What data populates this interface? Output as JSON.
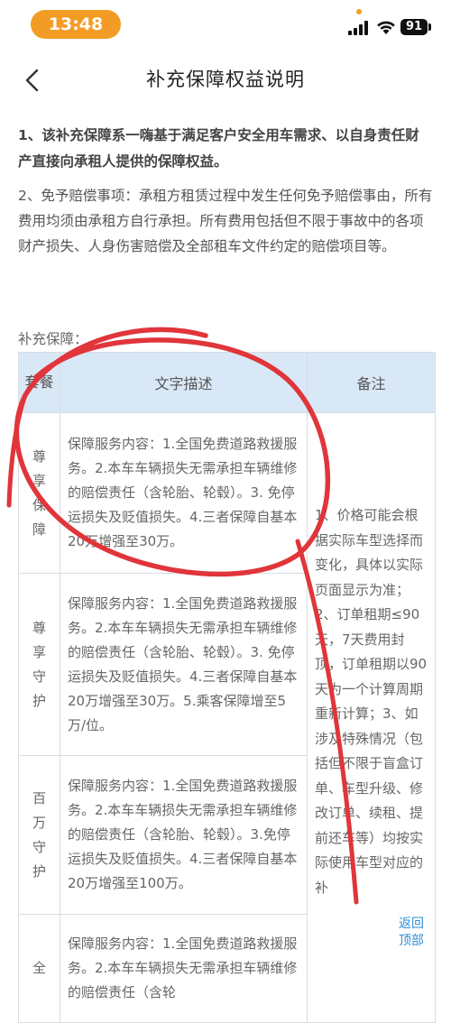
{
  "status": {
    "time": "13:48",
    "battery": "91"
  },
  "nav": {
    "title": "补充保障权益说明"
  },
  "content": {
    "p1": "1、该补充保障系一嗨基于满足客户安全用车需求、以自身责任财产直接向承租人提供的保障权益。",
    "p2": "2、免予赔偿事项：承租方租赁过程中发生任何免予赔偿事由，所有费用均须由承租方自行承担。所有费用包括但不限于事故中的各项财产损失、人身伤害赔偿及全部租车文件约定的赔偿项目等。",
    "table_label": "补充保障："
  },
  "table": {
    "headers": [
      "套餐",
      "文字描述",
      "备注"
    ],
    "rows": [
      {
        "package": "尊享保障",
        "description": "保障服务内容：1.全国免费道路救援服务。2.本车车辆损失无需承担车辆维修的赔偿责任（含轮胎、轮毂）。3. 免停运损失及贬值损失。4.三者保障自基本20万增强至30万。"
      },
      {
        "package": "尊享守护",
        "description": "保障服务内容：1.全国免费道路救援服务。2.本车车辆损失无需承担车辆维修的赔偿责任（含轮胎、轮毂）。3. 免停运损失及贬值损失。4.三者保障自基本20万增强至30万。5.乘客保障增至5万/位。"
      },
      {
        "package": "百万守护",
        "description": "保障服务内容：1.全国免费道路救援服务。2.本车车辆损失无需承担车辆维修的赔偿责任（含轮胎、轮毂）。3.免停运损失及贬值损失。4.三者保障自基本20万增强至100万。"
      },
      {
        "package": "全",
        "description": "保障服务内容：1.全国免费道路救援服务。2.本车车辆损失无需承担车辆维修的赔偿责任（含轮"
      }
    ],
    "note": "1、价格可能会根据实际车型选择而变化，具体以实际页面显示为准；2、订单租期≤90天，7天费用封顶，订单租期以90天为一个计算周期重新计算；3、如涉及特殊情况（包括但不限于盲盒订单、车型升级、修改订单、续租、提前还车等）均按实际使用车型对应的补"
  },
  "back_to_top": "返回顶部",
  "colors": {
    "time_pill": "#f39c25",
    "table_header_bg": "#d9e8f6",
    "annotation_red": "#e0353a",
    "link_blue": "#2f8fd6"
  }
}
